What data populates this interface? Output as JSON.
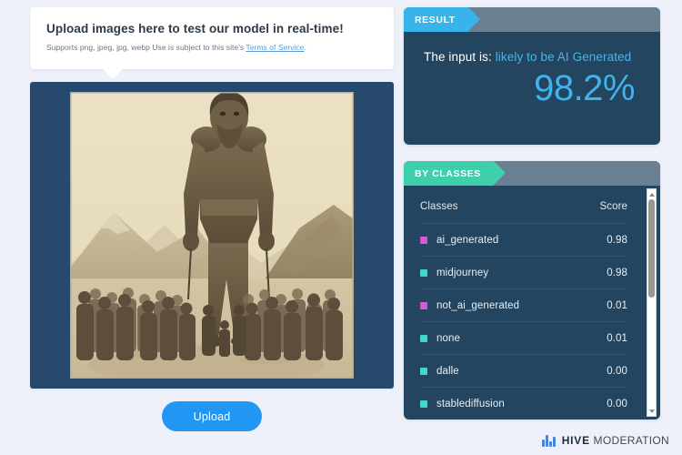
{
  "theme": {
    "page_bg": "#eef1f9",
    "panel_bg": "#24455f",
    "panel_header_bg": "#6a7f91",
    "result_tag_color": "#39b4ea",
    "classes_tag_color": "#3fcfad",
    "accent_blue": "#2196f3",
    "verdict_blue": "#4cb3e8",
    "frame_navy": "#27496d"
  },
  "upload_card": {
    "title": "Upload images here to test our model in real-time!",
    "subtitle_prefix": "Supports png, jpeg, jpg, webp Use is subject to this site's ",
    "terms_link": "Terms of Service",
    "subtitle_suffix": "."
  },
  "preview": {
    "alt": "sepia photo of a giant figure standing among a crowd of people in a mountain valley"
  },
  "upload_button": {
    "label": "Upload"
  },
  "result_panel": {
    "tag": "RESULT",
    "prefix": "The input is:",
    "verdict": "likely to be AI Generated",
    "percentage": "98.2%"
  },
  "classes_panel": {
    "tag": "BY CLASSES",
    "columns": {
      "name": "Classes",
      "score": "Score"
    },
    "rows": [
      {
        "name": "ai_generated",
        "score": "0.98",
        "color": "#d45ad4"
      },
      {
        "name": "midjourney",
        "score": "0.98",
        "color": "#3fd9c4"
      },
      {
        "name": "not_ai_generated",
        "score": "0.01",
        "color": "#d45ad4"
      },
      {
        "name": "none",
        "score": "0.01",
        "color": "#3fd9c4"
      },
      {
        "name": "dalle",
        "score": "0.00",
        "color": "#3fd9c4"
      },
      {
        "name": "stablediffusion",
        "score": "0.00",
        "color": "#3fd9c4"
      }
    ]
  },
  "footer": {
    "brand_bold": "HIVE",
    "brand_rest": "MODERATION"
  }
}
